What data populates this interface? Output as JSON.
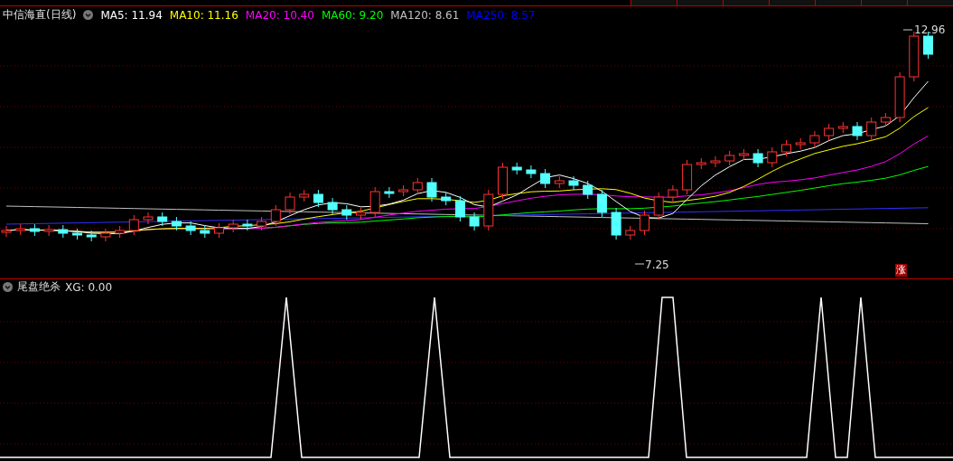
{
  "header": {
    "title": "中信海直(日线)",
    "indicators": [
      {
        "label": "MA5: 11.94",
        "color": "#ffffff"
      },
      {
        "label": "MA10: 11.16",
        "color": "#ffff00"
      },
      {
        "label": "MA20: 10.40",
        "color": "#ff00ff"
      },
      {
        "label": "MA60: 9.20",
        "color": "#00ff00"
      },
      {
        "label": "MA120: 8.61",
        "color": "#c0c0c0"
      },
      {
        "label": "MA250: 8.57",
        "color": "#0000ff"
      }
    ]
  },
  "chart": {
    "high_label": "12.96",
    "low_label": "7.25",
    "badge": "涨"
  },
  "indicator_pane": {
    "title": "尾盘绝杀",
    "reading": "XG: 0.00"
  }
}
